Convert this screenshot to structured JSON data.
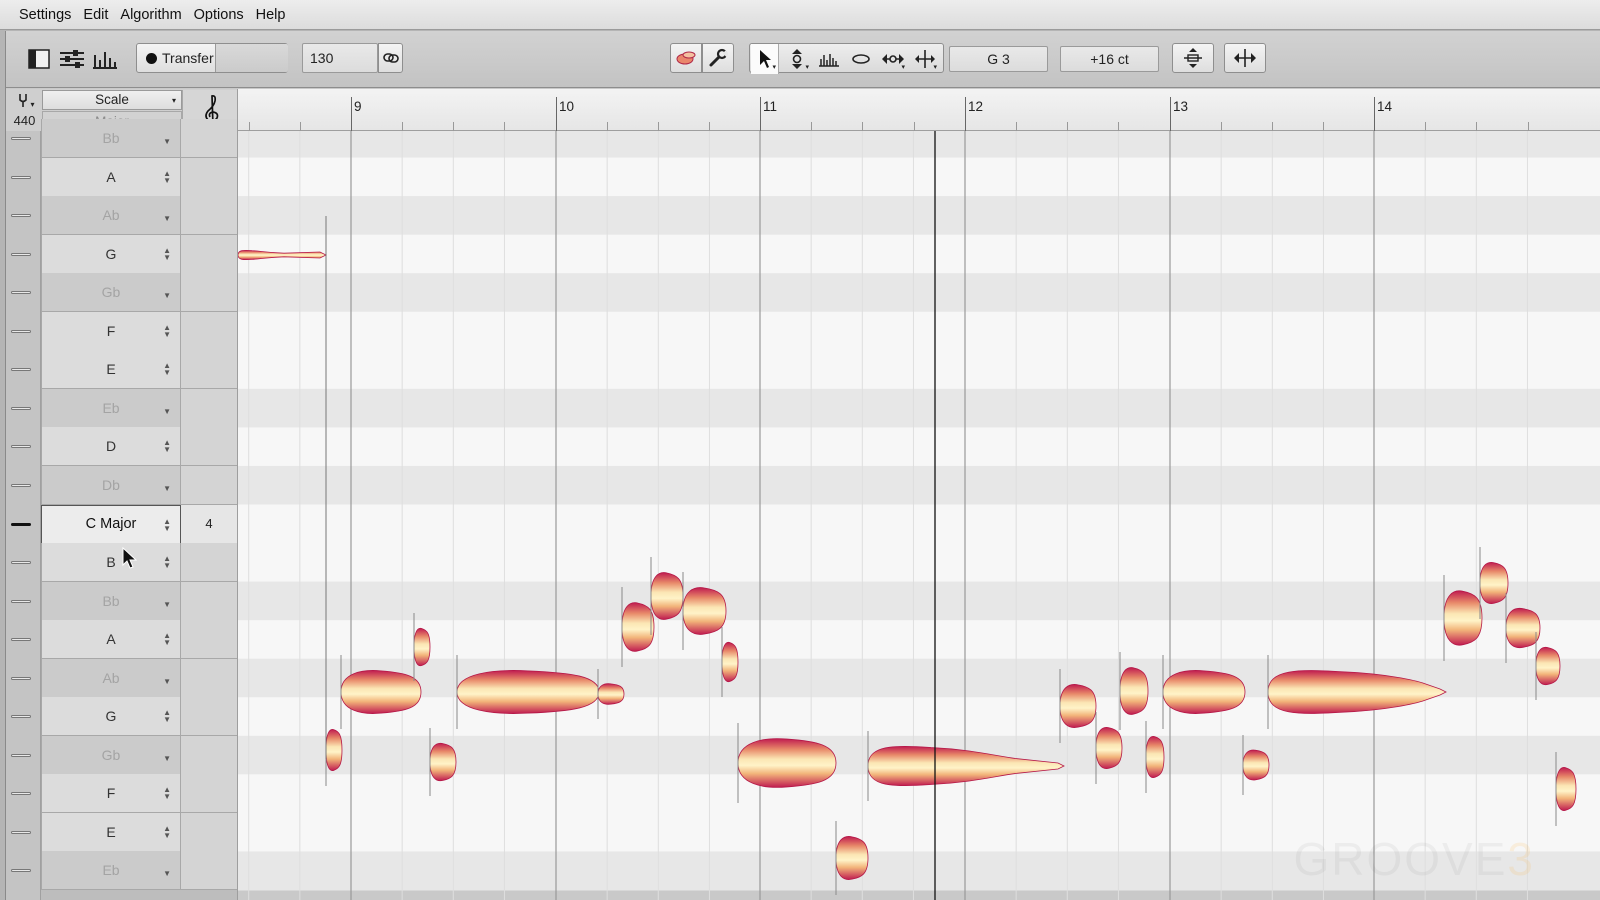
{
  "menu": [
    "Settings",
    "Edit",
    "Algorithm",
    "Options",
    "Help"
  ],
  "toolbar": {
    "transfer_label": "Transfer",
    "tempo_value": "130",
    "pitch_display": "G 3",
    "cents_display": "+16 ct",
    "tools": [
      "blob-tool-icon",
      "wrench-icon",
      "arrow-pointer-icon",
      "pitch-tool-icon",
      "formant-tool-icon",
      "amplitude-tool-icon",
      "time-tool-icon",
      "separation-tool-icon"
    ]
  },
  "header": {
    "reference_hz": "440",
    "scale_header": "Scale",
    "scale_mode": "Major"
  },
  "timeline": {
    "bars": [
      "9",
      "10",
      "11",
      "12",
      "13",
      "14"
    ]
  },
  "note_rows": [
    {
      "name": "Bb",
      "in_scale": false
    },
    {
      "name": "A",
      "in_scale": true
    },
    {
      "name": "Ab",
      "in_scale": false
    },
    {
      "name": "G",
      "in_scale": true
    },
    {
      "name": "Gb",
      "in_scale": false
    },
    {
      "name": "F",
      "in_scale": true
    },
    {
      "name": "E",
      "in_scale": true
    },
    {
      "name": "Eb",
      "in_scale": false
    },
    {
      "name": "D",
      "in_scale": true
    },
    {
      "name": "Db",
      "in_scale": false
    },
    {
      "name": "C Major",
      "in_scale": true,
      "root": true,
      "octave": "4"
    },
    {
      "name": "B",
      "in_scale": true
    },
    {
      "name": "Bb",
      "in_scale": false
    },
    {
      "name": "A",
      "in_scale": true
    },
    {
      "name": "Ab",
      "in_scale": false
    },
    {
      "name": "G",
      "in_scale": true
    },
    {
      "name": "Gb",
      "in_scale": false
    },
    {
      "name": "F",
      "in_scale": true
    },
    {
      "name": "E",
      "in_scale": true
    },
    {
      "name": "Eb",
      "in_scale": false
    }
  ],
  "colors": {
    "blob_core": "#fff3c8",
    "blob_mid": "#eeb074",
    "blob_edge": "#c01c50",
    "blob_selected": "#c0174f"
  },
  "watermark": {
    "word": "GROOVE",
    "number": "3"
  }
}
